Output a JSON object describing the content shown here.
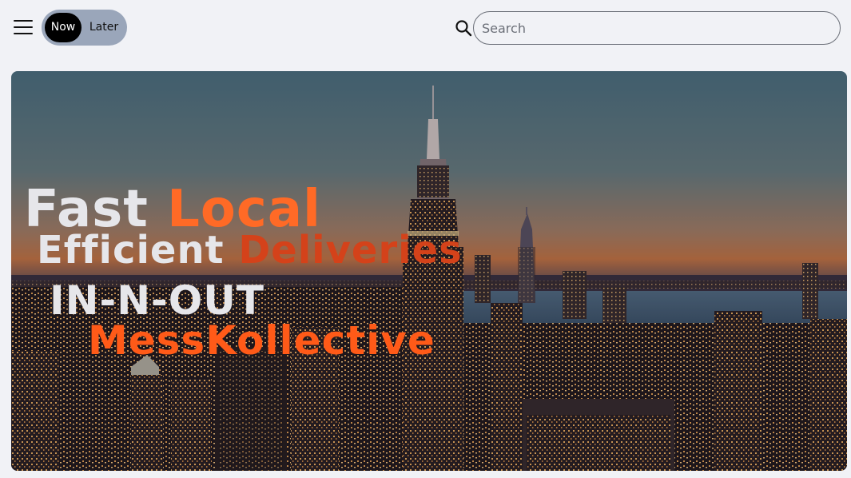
{
  "header": {
    "menu_icon": "hamburger-menu-icon",
    "toggle": {
      "now_label": "Now",
      "later_label": "Later",
      "selected": "Now"
    },
    "search": {
      "placeholder": "Search",
      "value": "",
      "icon": "search-icon"
    }
  },
  "hero": {
    "line1_a": "Fast",
    "line1_b": "Local",
    "line2_a": "Efficient",
    "line2_b": "Deliveries",
    "line3": "IN-N-OUT",
    "line4": "MessKollective",
    "colors": {
      "white": "#e6e6ea",
      "orange": "#ff6a26",
      "dark_orange": "#d4421a"
    }
  }
}
